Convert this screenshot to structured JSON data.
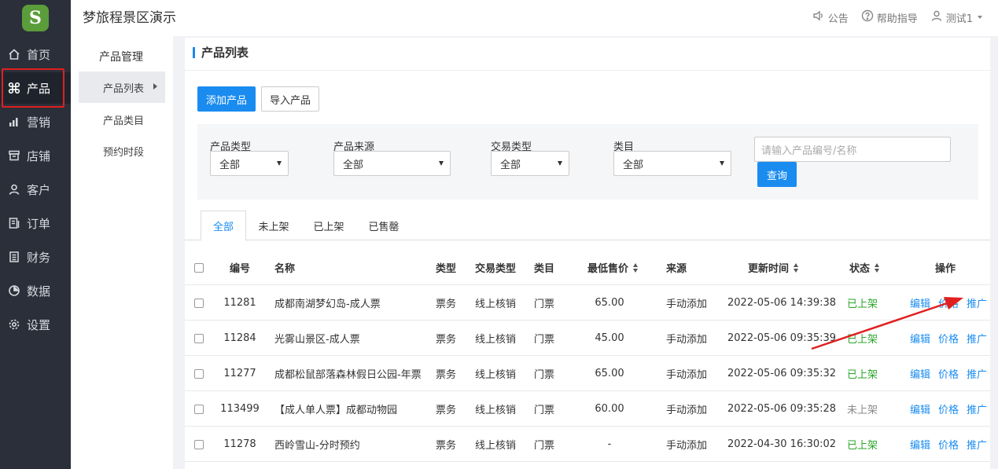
{
  "app": {
    "title": "梦旅程景区演示",
    "logo_letter": "S"
  },
  "header": {
    "notice": "公告",
    "help": "帮助指导",
    "user": "测试1"
  },
  "sidebar": {
    "items": [
      {
        "label": "首页",
        "icon": "home-icon"
      },
      {
        "label": "产品",
        "icon": "command-icon"
      },
      {
        "label": "营销",
        "icon": "bar-chart-icon"
      },
      {
        "label": "店铺",
        "icon": "store-icon"
      },
      {
        "label": "客户",
        "icon": "user-icon"
      },
      {
        "label": "订单",
        "icon": "order-icon"
      },
      {
        "label": "财务",
        "icon": "finance-icon"
      },
      {
        "label": "数据",
        "icon": "pie-chart-icon"
      },
      {
        "label": "设置",
        "icon": "gear-icon"
      }
    ]
  },
  "submenu": {
    "title": "产品管理",
    "items": [
      "产品列表",
      "产品类目",
      "预约时段"
    ]
  },
  "panel": {
    "title": "产品列表",
    "add_button": "添加产品",
    "import_button": "导入产品"
  },
  "filters": {
    "type_label": "产品类型",
    "type_value": "全部",
    "source_label": "产品来源",
    "source_value": "全部",
    "trade_label": "交易类型",
    "trade_value": "全部",
    "category_label": "类目",
    "category_value": "全部",
    "search_placeholder": "请输入产品编号/名称",
    "query_button": "查询"
  },
  "tabs": [
    "全部",
    "未上架",
    "已上架",
    "已售罄"
  ],
  "table": {
    "headers": {
      "id": "编号",
      "name": "名称",
      "type": "类型",
      "trade": "交易类型",
      "category": "类目",
      "price": "最低售价",
      "source": "来源",
      "updated": "更新时间",
      "status": "状态",
      "actions": "操作"
    },
    "actions": {
      "edit": "编辑",
      "price": "价格",
      "promote": "推广"
    },
    "rows": [
      {
        "id": "11281",
        "name": "成都南湖梦幻岛-成人票",
        "type": "票务",
        "trade": "线上核销",
        "category": "门票",
        "price": "65.00",
        "source": "手动添加",
        "updated": "2022-05-06 14:39:38",
        "status": "已上架"
      },
      {
        "id": "11284",
        "name": "光雾山景区-成人票",
        "type": "票务",
        "trade": "线上核销",
        "category": "门票",
        "price": "45.00",
        "source": "手动添加",
        "updated": "2022-05-06 09:35:39",
        "status": "已上架"
      },
      {
        "id": "11277",
        "name": "成都松鼠部落森林假日公园-年票",
        "type": "票务",
        "trade": "线上核销",
        "category": "门票",
        "price": "65.00",
        "source": "手动添加",
        "updated": "2022-05-06 09:35:32",
        "status": "已上架"
      },
      {
        "id": "113499",
        "name": "【成人单人票】成都动物园",
        "type": "票务",
        "trade": "线上核销",
        "category": "门票",
        "price": "60.00",
        "source": "手动添加",
        "updated": "2022-05-06 09:35:28",
        "status": "未上架"
      },
      {
        "id": "11278",
        "name": "西岭雪山-分时预约",
        "type": "票务",
        "trade": "线上核销",
        "category": "门票",
        "price": "-",
        "source": "手动添加",
        "updated": "2022-04-30 16:30:02",
        "status": "已上架"
      }
    ]
  },
  "colors": {
    "primary": "#1a8cf0",
    "sidebar": "#2b2f3a",
    "status_on": "#2aa52a",
    "annotation": "#e02020"
  }
}
